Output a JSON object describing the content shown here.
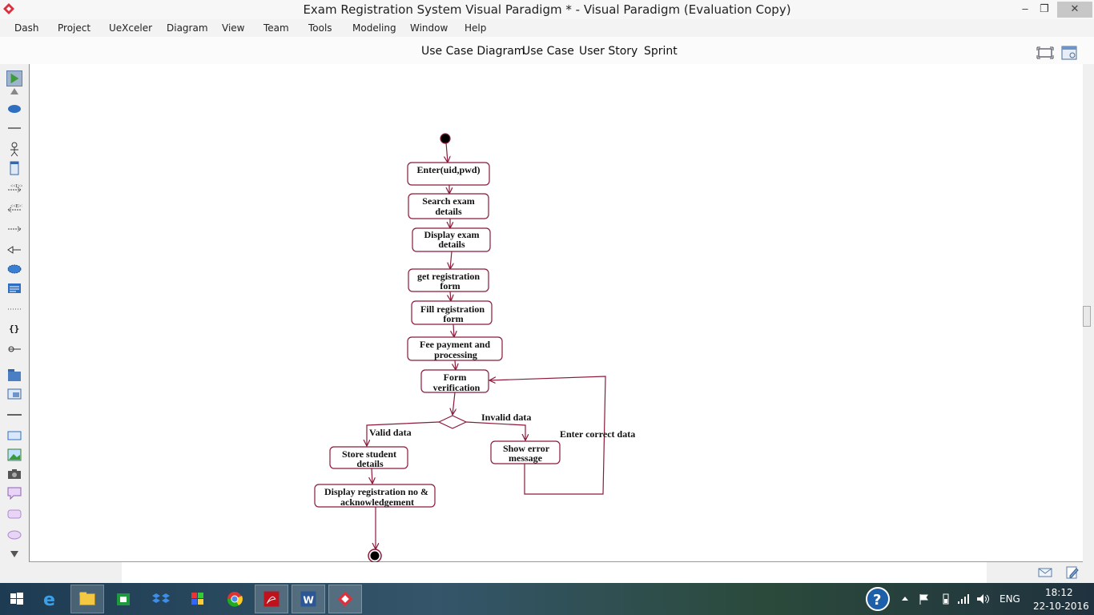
{
  "window": {
    "title": "Exam Registration System Visual Paradigm * - Visual Paradigm (Evaluation Copy)",
    "minimize_label": "–",
    "restore_label": "❐",
    "close_label": "✕"
  },
  "menu": [
    "Dash",
    "Project",
    "UeXceler",
    "Diagram",
    "View",
    "Team",
    "Tools",
    "Modeling",
    "Window",
    "Help"
  ],
  "diagram_tabs": [
    "Use Case Diagram",
    "Use Case",
    "User Story",
    "Sprint"
  ],
  "palette_icons": [
    "select-tool-icon",
    "scroll-up-icon",
    "use-case-icon",
    "association-icon",
    "actor-icon",
    "system-icon",
    "include-icon",
    "extend-icon",
    "dependency-icon",
    "generalization-icon",
    "collaboration-icon",
    "requirement-icon",
    "anchor-icon",
    "constraint-icon",
    "containment-icon",
    "package-icon",
    "model-icon",
    "line-icon",
    "rectangle-icon",
    "image-icon",
    "camera-icon",
    "callout-icon",
    "rounded-rect-icon",
    "ellipse-icon",
    "scroll-down-icon"
  ],
  "activity": {
    "nodes": {
      "enter": [
        "Enter(uid,pwd)"
      ],
      "search": [
        "Search exam",
        "details"
      ],
      "display": [
        "Display exam",
        "details"
      ],
      "get_form": [
        "get registration",
        "form"
      ],
      "fill": [
        "Fill registration",
        "form"
      ],
      "fee": [
        "Fee payment and",
        "processing"
      ],
      "verify": [
        "Form",
        "verification"
      ],
      "store": [
        "Store student",
        "details"
      ],
      "ack": [
        "Display registration no &",
        "acknowledgement"
      ],
      "error": [
        "Show error",
        "message"
      ]
    },
    "guards": {
      "valid": "Valid data",
      "invalid": "Invalid data",
      "correct": "Enter correct data"
    }
  },
  "taskbar": {
    "apps": [
      "start-icon",
      "internet-explorer-icon",
      "file-explorer-icon",
      "store-icon",
      "dropbox-icon",
      "photos-icon",
      "chrome-icon",
      "acrobat-icon",
      "word-icon",
      "visual-paradigm-icon"
    ],
    "language": "ENG",
    "time": "18:12",
    "date": "22-10-2016"
  },
  "colors": {
    "flow": "#8b1a3a",
    "accent": "#2a6ebb"
  }
}
